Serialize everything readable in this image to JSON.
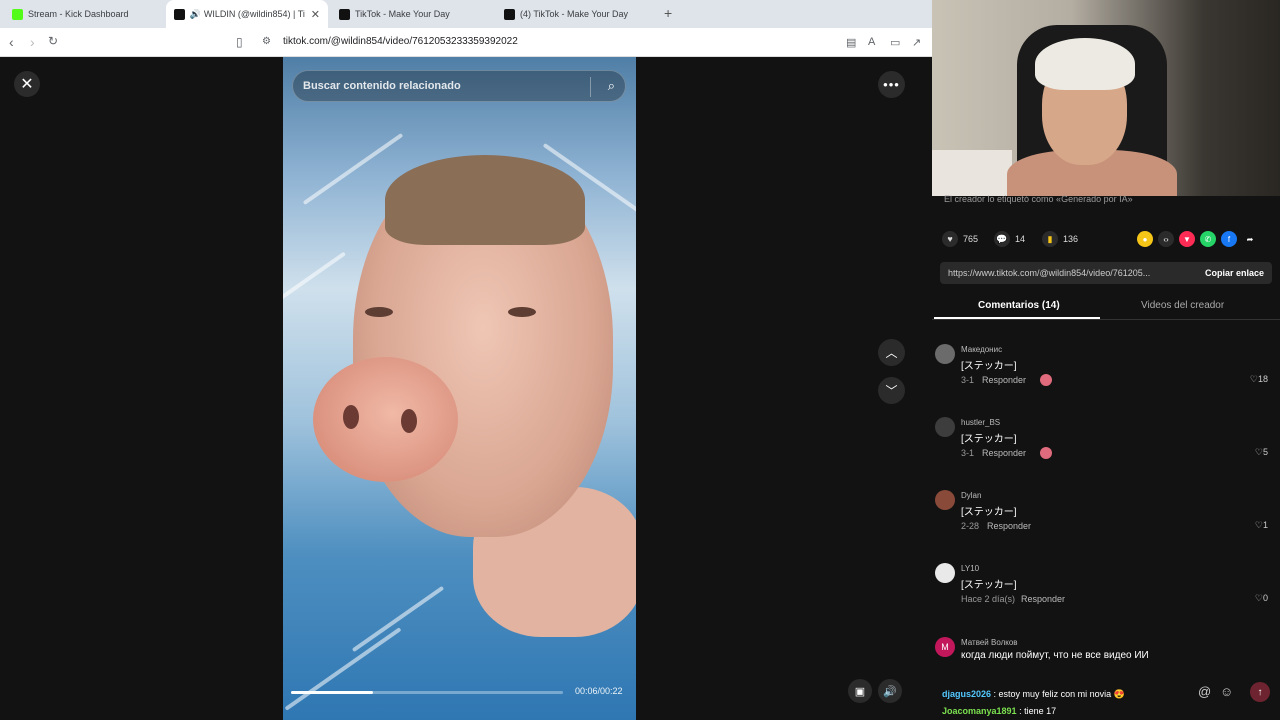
{
  "browser": {
    "tabs": [
      {
        "label": "Stream - Kick Dashboard",
        "favicon": "kick-icon"
      },
      {
        "label": "WILDIN (@wildin854) | TikTok",
        "favicon": "tiktok-icon",
        "active": true
      },
      {
        "label": "TikTok - Make Your Day",
        "favicon": "tiktok-icon"
      },
      {
        "label": "(4) TikTok - Make Your Day",
        "favicon": "tiktok-icon"
      }
    ],
    "new_tab": "+",
    "url": "tiktok.com/@wildin854/video/7612053233359392022"
  },
  "video": {
    "search_placeholder": "Buscar contenido relacionado",
    "time": "00:06/00:22",
    "progress": 0.3
  },
  "panel": {
    "ai_note": "El creador lo etiquetó como «Generado por IA»",
    "likes": "765",
    "comments": "14",
    "saves": "136",
    "link": "https://www.tiktok.com/@wildin854/video/761205...",
    "copy_label": "Copiar enlace",
    "tab_comments": "Comentarios (14)",
    "tab_creator": "Videos del creador"
  },
  "comments": [
    {
      "user": "Македонис",
      "text": "[ステッカー]",
      "date": "3-1",
      "reply": "Responder",
      "likes": "18",
      "sticker": true
    },
    {
      "user": "hustler_BS",
      "text": "[ステッカー]",
      "date": "3-1",
      "reply": "Responder",
      "likes": "5",
      "sticker": true
    },
    {
      "user": "Dylan",
      "text": "[ステッカー]",
      "date": "2-28",
      "reply": "Responder",
      "likes": "1",
      "sticker": false
    },
    {
      "user": "LY10",
      "text": "[ステッカー]",
      "date": "Hace 2 día(s)",
      "reply": "Responder",
      "likes": "0",
      "sticker": false
    },
    {
      "user": "Матвей Волков",
      "text": "когда люди поймут, что не все видео ИИ",
      "date": "",
      "reply": "",
      "likes": "",
      "sticker": false,
      "initial": "M"
    }
  ],
  "chat": [
    {
      "name": "djagus2026",
      "message": ": estoy muy feliz con mi novia 😍"
    },
    {
      "name": "Joacomanya1891",
      "message": ": tiene 17"
    }
  ],
  "colors": {
    "kick": "#53fc18",
    "accent_pink": "#fe2c55"
  }
}
